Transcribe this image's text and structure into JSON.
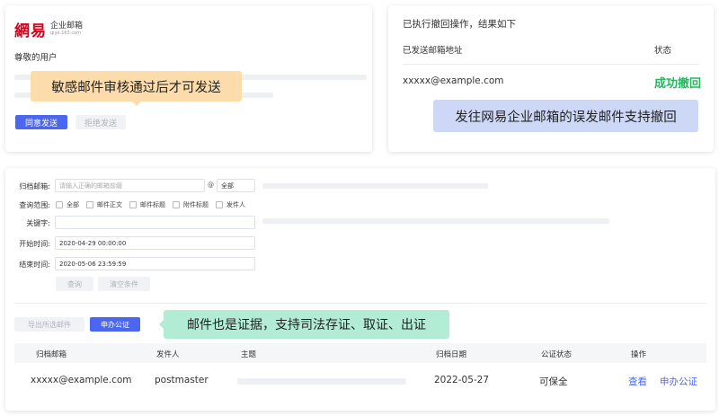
{
  "card1": {
    "logo_brand": "網易",
    "logo_name": "企业邮箱",
    "logo_domain": "qiye.163.com",
    "greeting": "尊敬的用户",
    "tooltip": "敏感邮件审核通过后才可发送",
    "approve_label": "同意发送",
    "reject_label": "拒绝发送"
  },
  "card2": {
    "heading": "已执行撤回操作，结果如下",
    "col_address": "已发送邮箱地址",
    "col_status": "状态",
    "row_address": "xxxxx@example.com",
    "row_status": "成功撤回",
    "banner": "发往网易企业邮箱的误发邮件支持撤回"
  },
  "search": {
    "archive_label": "归档邮箱:",
    "archive_placeholder": "请输入正确的邮箱前缀",
    "at_symbol": "@",
    "domain_value": "全部",
    "scope_label": "查询范围:",
    "scope_options": [
      "全部",
      "邮件正文",
      "邮件标题",
      "附件标题",
      "发件人"
    ],
    "keyword_label": "关键字:",
    "start_label": "开始时间:",
    "start_value": "2020-04-29 00:00:00",
    "end_label": "结束时间:",
    "end_value": "2020-05-06 23:59:59",
    "query_label": "查询",
    "clear_label": "清空条件",
    "export_label": "导出所选邮件",
    "notarize_label": "申办公证",
    "banner": "邮件也是证据，支持司法存证、取证、出证"
  },
  "table": {
    "headers": [
      "归档邮箱",
      "发件人",
      "主题",
      "归档日期",
      "公证状态",
      "操作"
    ],
    "row": {
      "mailbox": "xxxxx@example.com",
      "sender": "postmaster",
      "date": "2022-05-27",
      "status": "可保全",
      "action_view": "查看",
      "action_notarize": "申办公证"
    }
  },
  "colors": {
    "primary": "#4b67f2",
    "success": "#1fba5c",
    "tooltip_orange": "#fbdcaa",
    "banner_blue": "#cdd8f6",
    "banner_green": "#b3ecd4",
    "logo_red": "#d9001b"
  }
}
